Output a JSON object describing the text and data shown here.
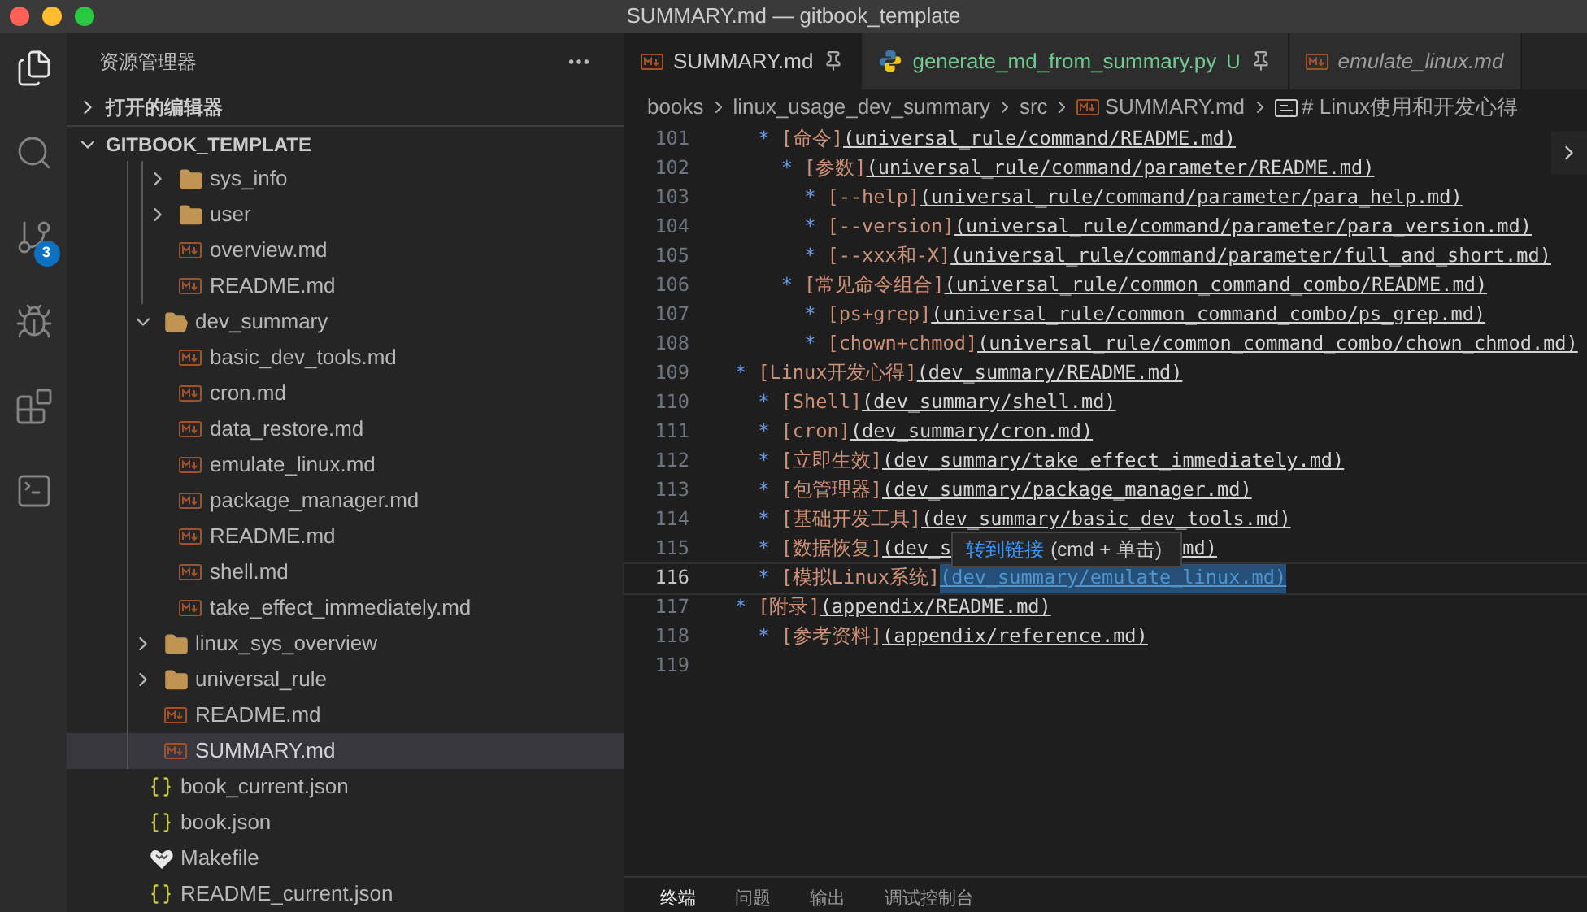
{
  "window": {
    "title": "SUMMARY.md — gitbook_template"
  },
  "activity_bar": [
    {
      "kind": "explorer",
      "selected": true
    },
    {
      "kind": "search",
      "selected": false
    },
    {
      "kind": "source-control",
      "selected": false,
      "badge": "3"
    },
    {
      "kind": "run",
      "selected": false
    },
    {
      "kind": "extensions",
      "selected": false
    },
    {
      "kind": "terminal",
      "selected": false
    }
  ],
  "sidebar": {
    "title": "资源管理器",
    "sections": [
      {
        "label": "打开的编辑器",
        "expanded": false
      },
      {
        "label": "GITBOOK_TEMPLATE",
        "expanded": true
      }
    ],
    "tree": [
      {
        "children": [
          {
            "children": [
              {
                "kind": "folder",
                "label": "sys_info",
                "expanded": false,
                "selected": false
              },
              {
                "kind": "folder",
                "label": "user",
                "expanded": false,
                "selected": false
              },
              {
                "kind": "markdown",
                "label": "overview.md",
                "selected": false
              },
              {
                "kind": "markdown",
                "label": "README.md",
                "selected": false
              }
            ]
          },
          {
            "kind": "folder",
            "label": "dev_summary",
            "expanded": true,
            "selected": false,
            "children": [
              {
                "kind": "markdown",
                "label": "basic_dev_tools.md",
                "selected": false
              },
              {
                "kind": "markdown",
                "label": "cron.md",
                "selected": false
              },
              {
                "kind": "markdown",
                "label": "data_restore.md",
                "selected": false
              },
              {
                "kind": "markdown",
                "label": "emulate_linux.md",
                "selected": false
              },
              {
                "kind": "markdown",
                "label": "package_manager.md",
                "selected": false
              },
              {
                "kind": "markdown",
                "label": "README.md",
                "selected": false
              },
              {
                "kind": "markdown",
                "label": "shell.md",
                "selected": false
              },
              {
                "kind": "markdown",
                "label": "take_effect_immediately.md",
                "selected": false
              }
            ]
          },
          {
            "kind": "folder",
            "label": "linux_sys_overview",
            "expanded": false,
            "selected": false
          },
          {
            "kind": "folder",
            "label": "universal_rule",
            "expanded": false,
            "selected": false
          },
          {
            "kind": "markdown",
            "label": "README.md",
            "selected": false
          },
          {
            "kind": "markdown",
            "label": "SUMMARY.md",
            "selected": true
          }
        ]
      },
      {
        "kind": "json",
        "label": "book_current.json",
        "selected": false
      },
      {
        "kind": "json",
        "label": "book.json",
        "selected": false
      },
      {
        "kind": "makefile",
        "label": "Makefile",
        "selected": false
      },
      {
        "kind": "json",
        "label": "README_current.json",
        "selected": false
      }
    ]
  },
  "tabs": [
    {
      "kind": "markdown",
      "label": "SUMMARY.md",
      "selected": true,
      "pinned": true,
      "preview": false
    },
    {
      "kind": "python",
      "label": "generate_md_from_summary.py",
      "selected": false,
      "pinned": true,
      "preview": false,
      "status": "U"
    },
    {
      "kind": "markdown",
      "label": "emulate_linux.md",
      "selected": false,
      "pinned": false,
      "preview": true
    }
  ],
  "breadcrumb": [
    {
      "kind": "folder",
      "label": "books"
    },
    {
      "kind": "folder",
      "label": "linux_usage_dev_summary"
    },
    {
      "kind": "folder",
      "label": "src"
    },
    {
      "kind": "markdown",
      "label": "SUMMARY.md"
    },
    {
      "kind": "symbol",
      "label": "# Linux使用和开发心得"
    }
  ],
  "code_lines": [
    {
      "number": "101",
      "bullet": "  *",
      "label": "[命令]",
      "link": "(universal_rule/command/README.md)",
      "active": false
    },
    {
      "number": "102",
      "bullet": "    *",
      "label": "[参数]",
      "link": "(universal_rule/command/parameter/README.md)",
      "active": false
    },
    {
      "number": "103",
      "bullet": "      *",
      "label": "[--help]",
      "link": "(universal_rule/command/parameter/para_help.md)",
      "active": false
    },
    {
      "number": "104",
      "bullet": "      *",
      "label": "[--version]",
      "link": "(universal_rule/command/parameter/para_version.md)",
      "active": false
    },
    {
      "number": "105",
      "bullet": "      *",
      "label": "[--xxx和-X]",
      "link": "(universal_rule/command/parameter/full_and_short.md)",
      "active": false
    },
    {
      "number": "106",
      "bullet": "    *",
      "label": "[常见命令组合]",
      "link": "(universal_rule/common_command_combo/README.md)",
      "active": false
    },
    {
      "number": "107",
      "bullet": "      *",
      "label": "[ps+grep]",
      "link": "(universal_rule/common_command_combo/ps_grep.md)",
      "active": false
    },
    {
      "number": "108",
      "bullet": "      *",
      "label": "[chown+chmod]",
      "link": "(universal_rule/common_command_combo/chown_chmod.md)",
      "active": false
    },
    {
      "number": "109",
      "bullet": "*",
      "label": "[Linux开发心得]",
      "link": "(dev_summary/README.md)",
      "active": false
    },
    {
      "number": "110",
      "bullet": "  *",
      "label": "[Shell]",
      "link": "(dev_summary/shell.md)",
      "active": false
    },
    {
      "number": "111",
      "bullet": "  *",
      "label": "[cron]",
      "link": "(dev_summary/cron.md)",
      "active": false
    },
    {
      "number": "112",
      "bullet": "  *",
      "label": "[立即生效]",
      "link": "(dev_summary/take_effect_immediately.md)",
      "active": false
    },
    {
      "number": "113",
      "bullet": "  *",
      "label": "[包管理器]",
      "link": "(dev_summary/package_manager.md)",
      "active": false
    },
    {
      "number": "114",
      "bullet": "  *",
      "label": "[基础开发工具]",
      "link": "(dev_summary/basic_dev_tools.md)",
      "active": false
    },
    {
      "number": "115",
      "bullet": "  *",
      "label": "[数据恢复]",
      "link": "(dev_s",
      "link_end": "md)",
      "active": false
    },
    {
      "number": "116",
      "bullet": "  *",
      "label": "[模拟Linux系统]",
      "link": "(dev_summary/emulate_linux.md)",
      "active": true
    },
    {
      "number": "117",
      "bullet": "*",
      "label": "[附录]",
      "link": "(appendix/README.md)",
      "active": false
    },
    {
      "number": "118",
      "bullet": "  *",
      "label": "[参考资料]",
      "link": "(appendix/reference.md)",
      "active": false
    },
    {
      "number": "119",
      "active": false
    }
  ],
  "tooltip": {
    "link": "转到链接",
    "hint": "(cmd + 单击)"
  },
  "panel_tabs": [
    {
      "label": "终端",
      "selected": true
    },
    {
      "label": "问题",
      "selected": false
    },
    {
      "label": "输出",
      "selected": false
    },
    {
      "label": "调试控制台",
      "selected": false
    }
  ]
}
